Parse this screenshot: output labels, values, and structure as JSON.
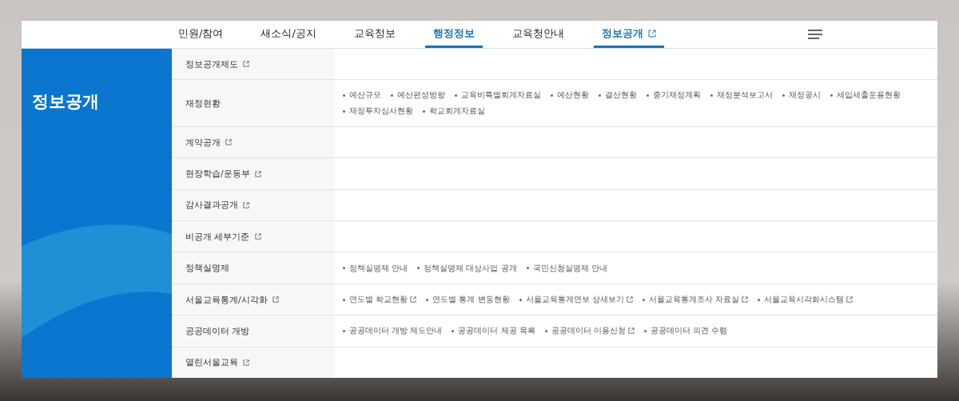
{
  "nav": [
    {
      "label": "민원/참여",
      "selected": false,
      "external": false
    },
    {
      "label": "새소식/공지",
      "selected": false,
      "external": false
    },
    {
      "label": "교육정보",
      "selected": false,
      "external": false
    },
    {
      "label": "행정정보",
      "selected": true,
      "external": false
    },
    {
      "label": "교육청안내",
      "selected": false,
      "external": false
    },
    {
      "label": "정보공개",
      "selected": true,
      "external": true
    }
  ],
  "sidebar": {
    "title": "정보공개"
  },
  "menu": [
    {
      "label": "정보공개제도",
      "external": true
    },
    {
      "label": "재정현황",
      "external": false,
      "links": [
        {
          "label": "예산규모",
          "external": false
        },
        {
          "label": "예산편성방향",
          "external": false
        },
        {
          "label": "교육비특별회계자료실",
          "external": false
        },
        {
          "label": "예산현황",
          "external": false
        },
        {
          "label": "결산현황",
          "external": false
        },
        {
          "label": "중기재정계획",
          "external": false
        },
        {
          "label": "재정분석보고서",
          "external": false
        },
        {
          "label": "재정공시",
          "external": false
        },
        {
          "label": "세입세출운용현황",
          "external": false
        },
        {
          "label": "재정투자심사현황",
          "external": false
        },
        {
          "label": "학교회계자료실",
          "external": false
        }
      ]
    },
    {
      "label": "계약공개",
      "external": true
    },
    {
      "label": "현장학습/운동부",
      "external": true
    },
    {
      "label": "감사결과공개",
      "external": true
    },
    {
      "label": "비공개 세부기준",
      "external": true
    },
    {
      "label": "정책실명제",
      "external": false,
      "links": [
        {
          "label": "정책실명제 안내",
          "external": false
        },
        {
          "label": "정책실명제 대상사업 공개",
          "external": false
        },
        {
          "label": "국민신청실명제 안내",
          "external": false
        }
      ]
    },
    {
      "label": "서울교육통계/시각화",
      "external": true,
      "links": [
        {
          "label": "연도별 학교현황",
          "external": true
        },
        {
          "label": "연도별 통계 변동현황",
          "external": false
        },
        {
          "label": "서울교육통계연보 상세보기",
          "external": true
        },
        {
          "label": "서울교육통계조사 자료실",
          "external": true
        },
        {
          "label": "서울교육시각화시스템",
          "external": true
        }
      ]
    },
    {
      "label": "공공데이터 개방",
      "external": false,
      "links": [
        {
          "label": "공공데이터 개방 제도안내",
          "external": false
        },
        {
          "label": "공공데이터 제공 목록",
          "external": false
        },
        {
          "label": "공공데이터 이용신청",
          "external": true
        },
        {
          "label": "공공데이터 의견 수렴",
          "external": false
        }
      ]
    },
    {
      "label": "열린서울교육",
      "external": true
    }
  ]
}
